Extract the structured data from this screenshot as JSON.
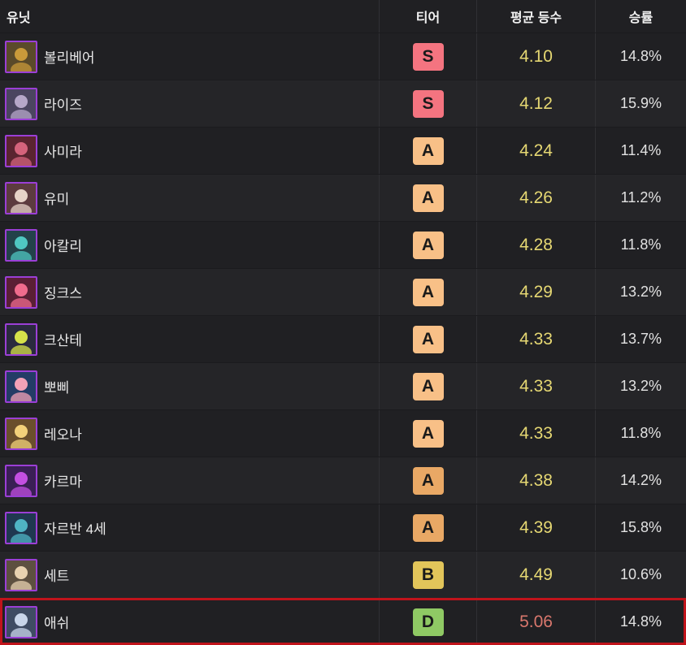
{
  "header": {
    "unit": "유닛",
    "tier": "티어",
    "avg": "평균 등수",
    "win": "승률"
  },
  "colors": {
    "tier_S": "#f47480",
    "tier_A": "#f8c087",
    "tier_A2": "#e9a865",
    "tier_B": "#e2c55a",
    "tier_D": "#8fc964",
    "avg_good": "#e6d873",
    "avg_bad": "#d9776d",
    "highlight": "#c0141b"
  },
  "rows": [
    {
      "name": "볼리베어",
      "tier": "S",
      "avg": "4.10",
      "win": "14.8%",
      "portrait": "volibear-portrait-icon",
      "bg": "#5a4a2a",
      "fg": "#c99a3a"
    },
    {
      "name": "라이즈",
      "tier": "S",
      "avg": "4.12",
      "win": "15.9%",
      "portrait": "ryze-portrait-icon",
      "bg": "#4b4560",
      "fg": "#b6a7c9"
    },
    {
      "name": "사미라",
      "tier": "A",
      "avg": "4.24",
      "win": "11.4%",
      "portrait": "samira-portrait-icon",
      "bg": "#5a2430",
      "fg": "#d4637c"
    },
    {
      "name": "유미",
      "tier": "A",
      "avg": "4.26",
      "win": "11.2%",
      "portrait": "yuumi-portrait-icon",
      "bg": "#5c3b3f",
      "fg": "#e6d3c8"
    },
    {
      "name": "아칼리",
      "tier": "A",
      "avg": "4.28",
      "win": "11.8%",
      "portrait": "akali-portrait-icon",
      "bg": "#23424a",
      "fg": "#4fc7c2"
    },
    {
      "name": "징크스",
      "tier": "A",
      "avg": "4.29",
      "win": "13.2%",
      "portrait": "jinx-portrait-icon",
      "bg": "#5a1f35",
      "fg": "#ef6b8d"
    },
    {
      "name": "크산테",
      "tier": "A",
      "avg": "4.33",
      "win": "13.7%",
      "portrait": "ksante-portrait-icon",
      "bg": "#2a2a3e",
      "fg": "#d6e14a"
    },
    {
      "name": "뽀삐",
      "tier": "A",
      "avg": "4.33",
      "win": "13.2%",
      "portrait": "poppy-portrait-icon",
      "bg": "#233c66",
      "fg": "#f3a1b7"
    },
    {
      "name": "레오나",
      "tier": "A",
      "avg": "4.33",
      "win": "11.8%",
      "portrait": "leona-portrait-icon",
      "bg": "#6a4f2c",
      "fg": "#f3d17a"
    },
    {
      "name": "카르마",
      "tier": "A",
      "avg": "4.38",
      "win": "14.2%",
      "portrait": "karma-portrait-icon",
      "bg": "#3a1f55",
      "fg": "#c24fe0"
    },
    {
      "name": "자르반 4세",
      "tier": "A",
      "avg": "4.39",
      "win": "15.8%",
      "portrait": "jarvan-portrait-icon",
      "bg": "#1f3850",
      "fg": "#4fb4c4"
    },
    {
      "name": "세트",
      "tier": "B",
      "avg": "4.49",
      "win": "10.6%",
      "portrait": "sett-portrait-icon",
      "bg": "#5d5040",
      "fg": "#e8d2b0"
    },
    {
      "name": "애쉬",
      "tier": "D",
      "avg": "5.06",
      "win": "14.8%",
      "portrait": "ashe-portrait-icon",
      "bg": "#3f4c63",
      "fg": "#c9d6ea"
    }
  ]
}
